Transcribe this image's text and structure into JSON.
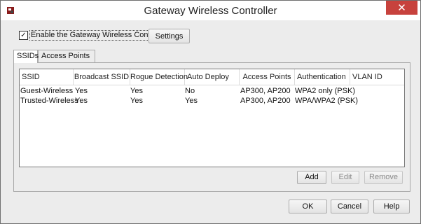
{
  "window": {
    "title": "Gateway Wireless Controller",
    "close_glyph": "✕"
  },
  "enable": {
    "label": "Enable the Gateway Wireless Controller",
    "checked": true,
    "check_glyph": "✓"
  },
  "settings_button": {
    "label": "Settings"
  },
  "tabs": [
    {
      "label": "SSIDs",
      "active": true
    },
    {
      "label": "Access Points",
      "active": false
    }
  ],
  "table": {
    "columns": [
      "SSID",
      "Broadcast SSID",
      "Rogue Detection",
      "Auto Deploy",
      "Access Points",
      "Authentication",
      "VLAN ID"
    ],
    "rows": [
      [
        "Guest-Wireless",
        "Yes",
        "Yes",
        "No",
        "AP300, AP200",
        "WPA2 only (PSK)",
        ""
      ],
      [
        "Trusted-Wireless",
        "Yes",
        "Yes",
        "Yes",
        "AP300, AP200",
        "WPA/WPA2 (PSK)",
        ""
      ]
    ]
  },
  "table_buttons": {
    "add": "Add",
    "edit": "Edit",
    "remove": "Remove"
  },
  "dialog_buttons": {
    "ok": "OK",
    "cancel": "Cancel",
    "help": "Help"
  },
  "icons": {
    "app": "firewall-app-icon",
    "close": "close-icon"
  },
  "colors": {
    "close_button": "#c7423d",
    "dialog_background": "#ececec"
  }
}
